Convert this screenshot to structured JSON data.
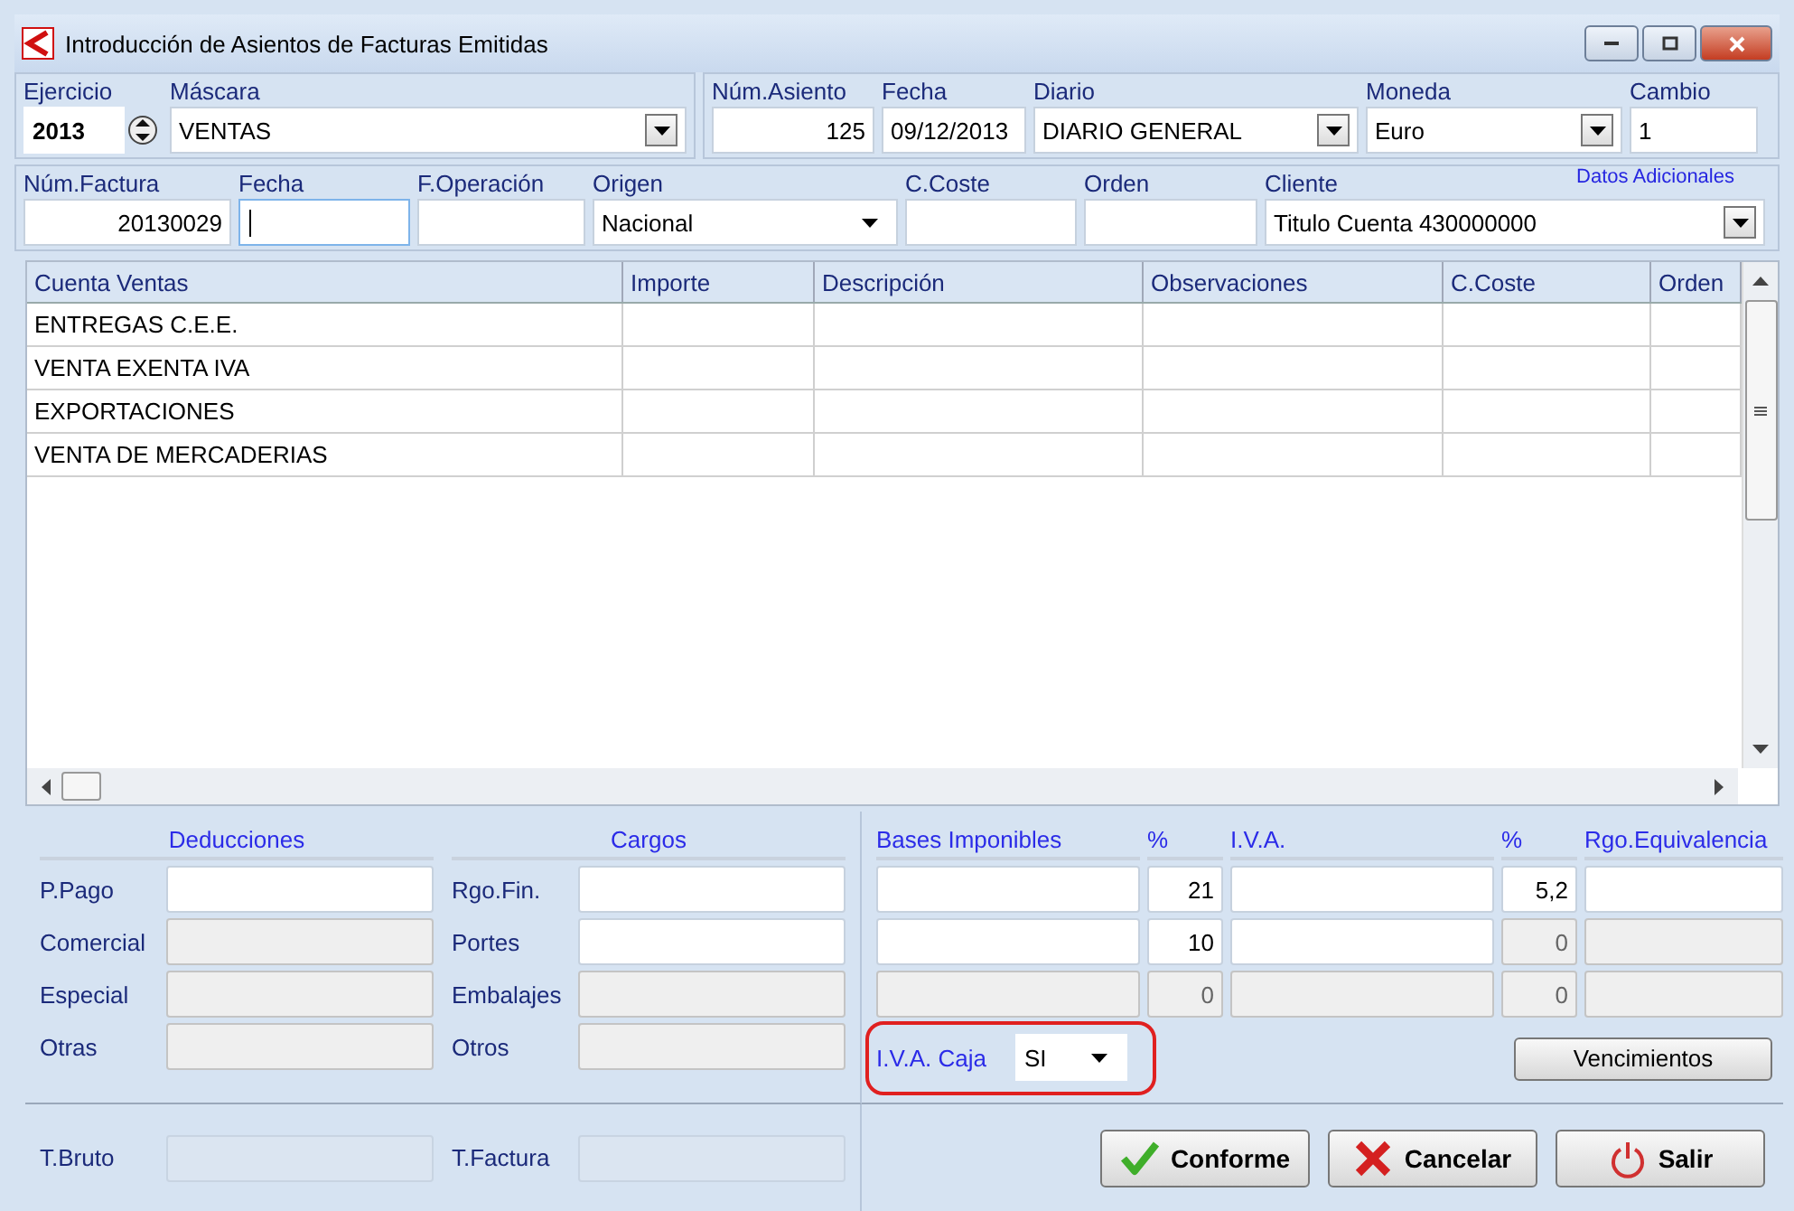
{
  "window": {
    "title": "Introducción de Asientos de Facturas Emitidas"
  },
  "header_left": [
    {
      "label": "Ejercicio",
      "value": "2013",
      "kind": "spinner"
    },
    {
      "label": "Máscara",
      "value": "VENTAS",
      "kind": "dropdown"
    }
  ],
  "header_right": [
    {
      "label": "Núm.Asiento",
      "value": "125",
      "kind": "number"
    },
    {
      "label": "Fecha",
      "value": "09/12/2013",
      "kind": "text"
    },
    {
      "label": "Diario",
      "value": "DIARIO GENERAL",
      "kind": "dropdown"
    },
    {
      "label": "Moneda",
      "value": "Euro",
      "kind": "dropdown"
    },
    {
      "label": "Cambio",
      "value": "1",
      "kind": "text"
    }
  ],
  "header_second": [
    {
      "label": "Núm.Factura",
      "value": "20130029",
      "kind": "number"
    },
    {
      "label": "Fecha",
      "kind": "text",
      "focused": true
    },
    {
      "label": "F.Operación",
      "kind": "text"
    },
    {
      "label": "Origen",
      "value": "Nacional",
      "kind": "combo"
    },
    {
      "label": "C.Coste",
      "kind": "text"
    },
    {
      "label": "Orden",
      "kind": "text"
    },
    {
      "label": "Cliente",
      "value": "Titulo Cuenta 430000000",
      "kind": "dropdown"
    }
  ],
  "extra_link": "Datos Adicionales",
  "table": {
    "columns": [
      "Cuenta Ventas",
      "Importe",
      "Descripción",
      "Observaciones",
      "C.Coste",
      "Orden"
    ],
    "rows": [
      "ENTREGAS C.E.E.",
      "VENTA EXENTA IVA",
      "EXPORTACIONES",
      "VENTA DE MERCADERIAS"
    ]
  },
  "deducciones": {
    "title": "Deducciones",
    "rows": [
      {
        "label": "P.Pago",
        "disabled": false
      },
      {
        "label": "Comercial",
        "disabled": true
      },
      {
        "label": "Especial",
        "disabled": true
      },
      {
        "label": "Otras",
        "disabled": true
      }
    ]
  },
  "cargos": {
    "title": "Cargos",
    "rows": [
      {
        "label": "Rgo.Fin.",
        "disabled": false
      },
      {
        "label": "Portes",
        "disabled": false
      },
      {
        "label": "Embalajes",
        "disabled": true
      },
      {
        "label": "Otros",
        "disabled": true
      }
    ]
  },
  "impuestos": {
    "columns": [
      "Bases Imponibles",
      "%",
      "I.V.A.",
      "%",
      "Rgo.Equivalencia"
    ],
    "rows": [
      [
        {
          "disabled": false
        },
        {
          "value": "21",
          "disabled": false
        },
        {
          "disabled": false
        },
        {
          "value": "5,2",
          "disabled": false
        },
        {
          "disabled": false
        }
      ],
      [
        {
          "disabled": false
        },
        {
          "value": "10",
          "disabled": false
        },
        {
          "disabled": false
        },
        {
          "value": "0",
          "disabled": true
        },
        {
          "disabled": true
        }
      ],
      [
        {
          "disabled": true
        },
        {
          "value": "0",
          "disabled": true
        },
        {
          "disabled": true
        },
        {
          "value": "0",
          "disabled": true
        },
        {
          "disabled": true
        }
      ]
    ]
  },
  "iva_caja": {
    "label": "I.V.A. Caja",
    "value": "SI",
    "highlighted": true
  },
  "vencimientos_button": "Vencimientos",
  "totals": [
    {
      "label": "T.Bruto",
      "disabled": true
    },
    {
      "label": "T.Factura",
      "disabled": true
    }
  ],
  "actions": [
    {
      "label": "Conforme",
      "kind": "ok"
    },
    {
      "label": "Cancelar",
      "kind": "cancel"
    },
    {
      "label": "Salir",
      "kind": "exit"
    }
  ]
}
